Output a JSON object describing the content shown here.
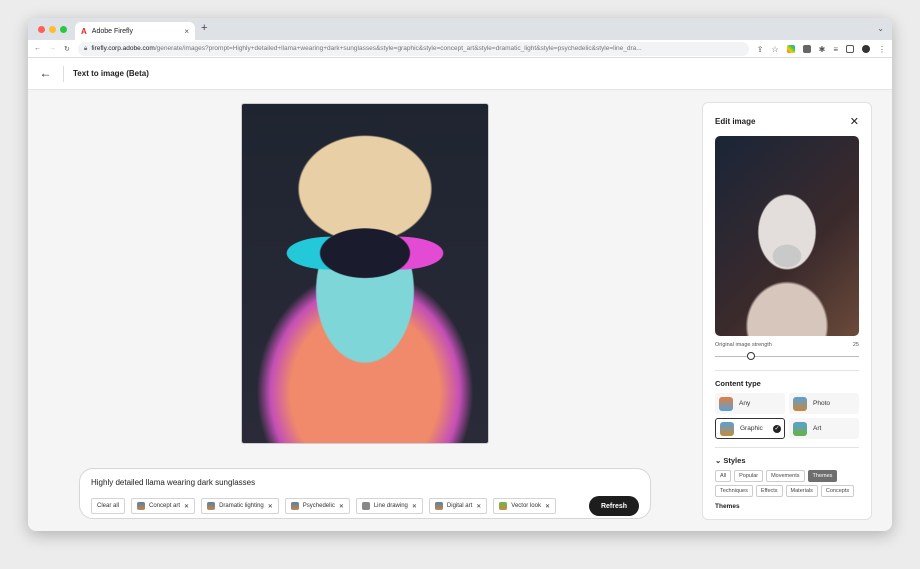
{
  "browser": {
    "tab_title": "Adobe Firefly",
    "url_host": "firefly.corp.adobe.com",
    "url_path": "/generate/images?prompt=Highly+detailed+llama+wearing+dark+sunglasses&style=graphic&style=concept_art&style=dramatic_light&style=psychedelic&style=line_dra..."
  },
  "header": {
    "title": "Text to image (Beta)"
  },
  "panel": {
    "title": "Edit image",
    "strength_label": "Original image strength",
    "strength_value": "25",
    "strength_fraction": 0.25,
    "content_type_title": "Content type",
    "content_types": [
      {
        "label": "Any"
      },
      {
        "label": "Photo"
      },
      {
        "label": "Graphic",
        "selected": true
      },
      {
        "label": "Art"
      }
    ],
    "styles_title": "Styles",
    "style_filters": [
      "All",
      "Popular",
      "Movements",
      "Themes",
      "Techniques",
      "Effects",
      "Materials",
      "Concepts"
    ],
    "active_filter": "Themes",
    "themes_title": "Themes"
  },
  "prompt": {
    "text": "Highly detailed llama wearing dark sunglasses",
    "clear_all": "Clear all",
    "tags": [
      "Concept art",
      "Dramatic lighting",
      "Psychedelic",
      "Line drawing",
      "Digital art",
      "Vector look"
    ],
    "refresh": "Refresh"
  }
}
